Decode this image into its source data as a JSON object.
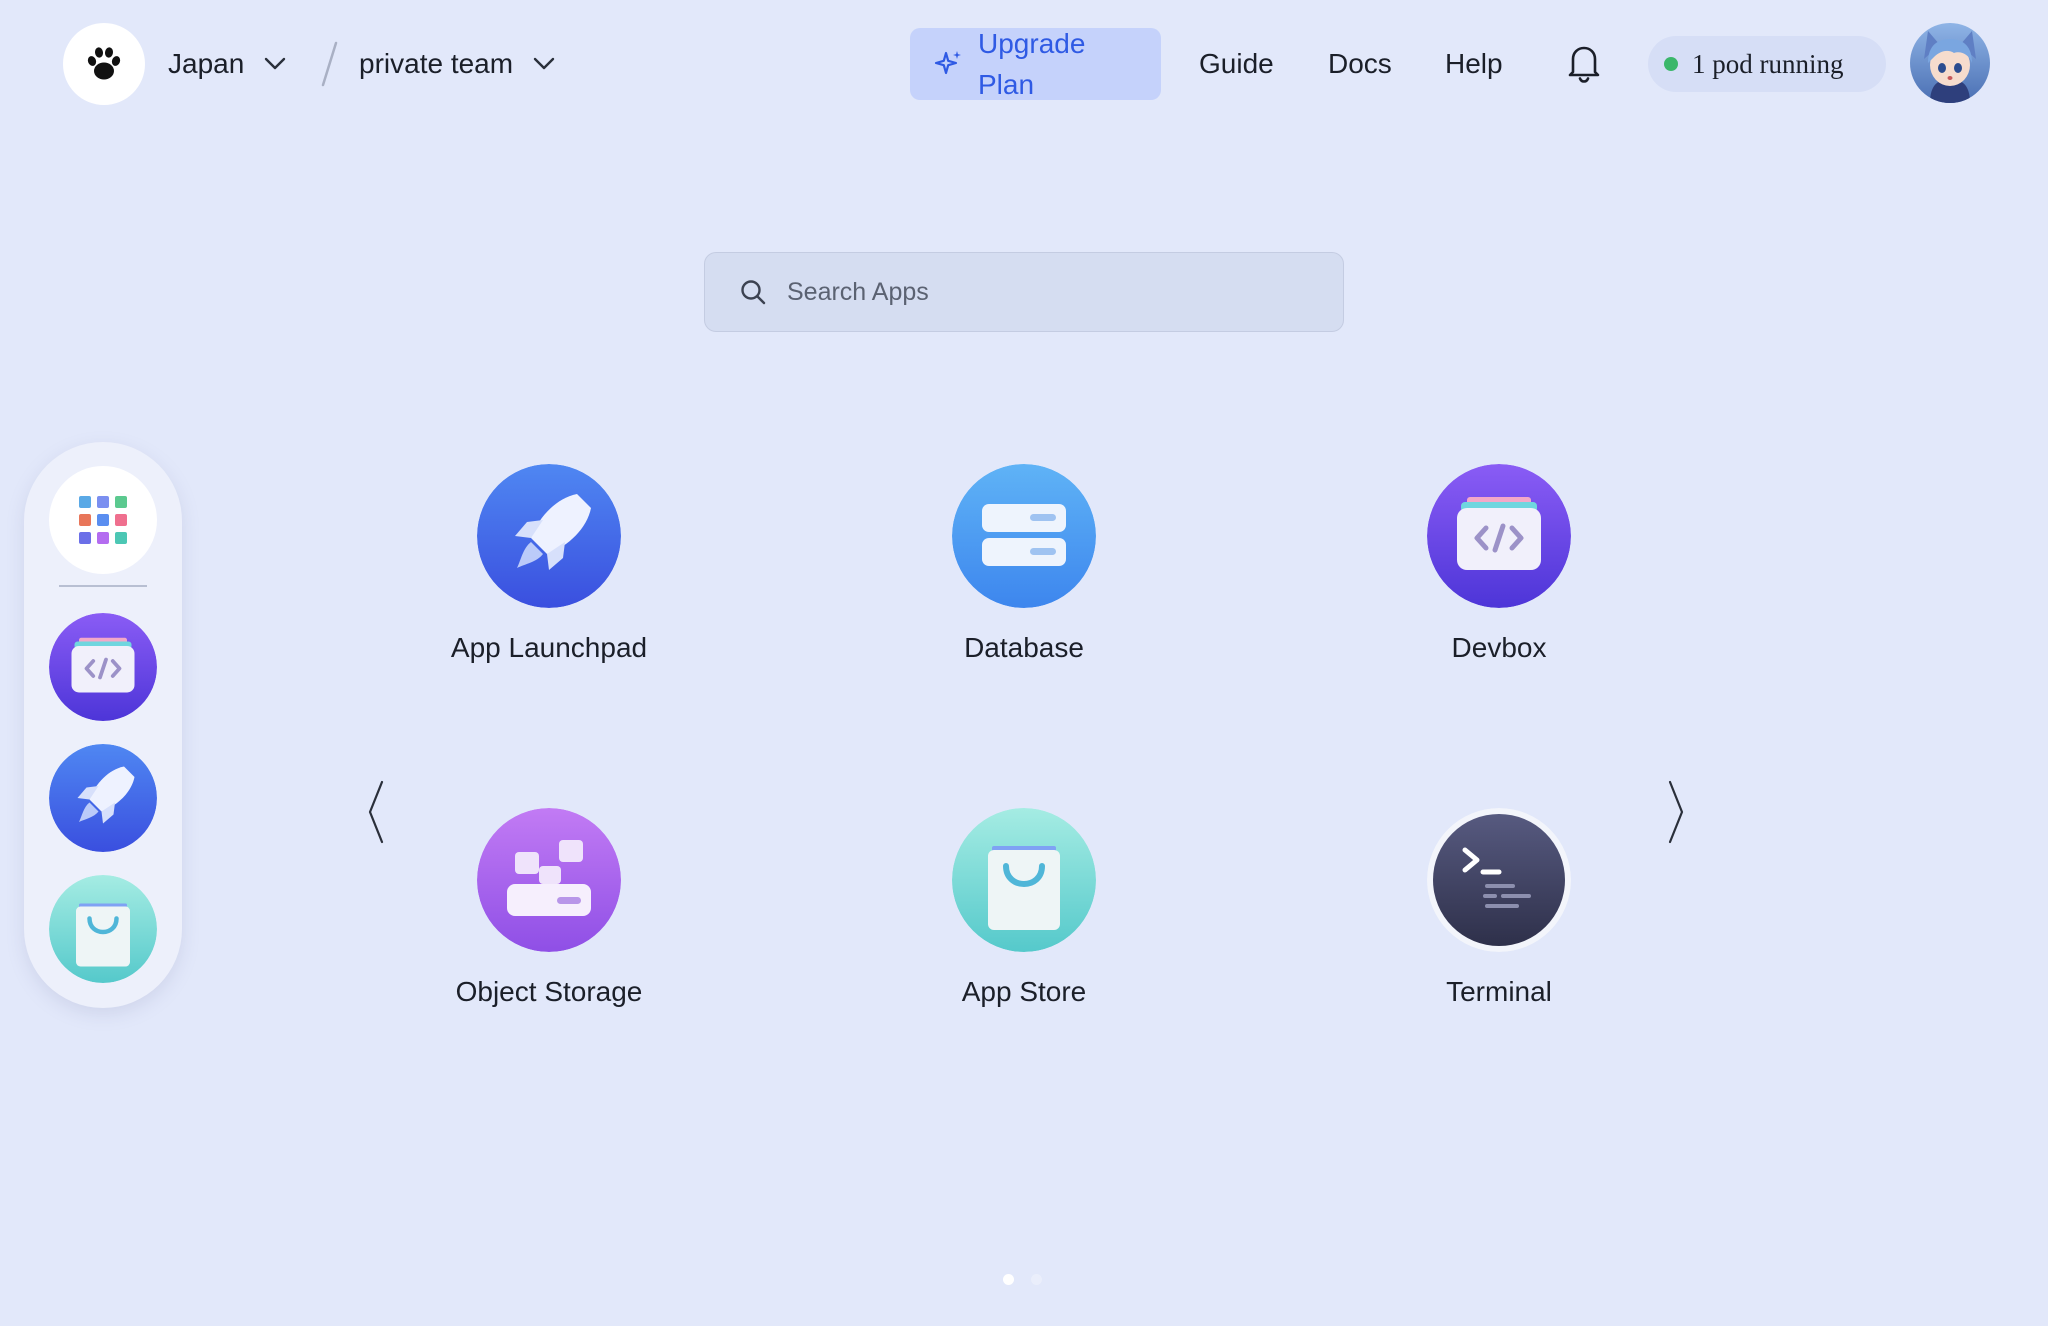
{
  "header": {
    "region": "Japan",
    "team": "private team",
    "upgrade_label": "Upgrade Plan",
    "nav": [
      "Guide",
      "Docs",
      "Help"
    ],
    "pod_status": "1 pod running"
  },
  "search": {
    "placeholder": "Search Apps"
  },
  "apps": [
    "App Launchpad",
    "Database",
    "Devbox",
    "Object Storage",
    "App Store",
    "Terminal"
  ],
  "pagination": {
    "pages": 2,
    "current": 1
  },
  "colors": {
    "background": "#e2e8fa",
    "accent": "#2f5ae4",
    "status_ok": "#3bb76b"
  }
}
